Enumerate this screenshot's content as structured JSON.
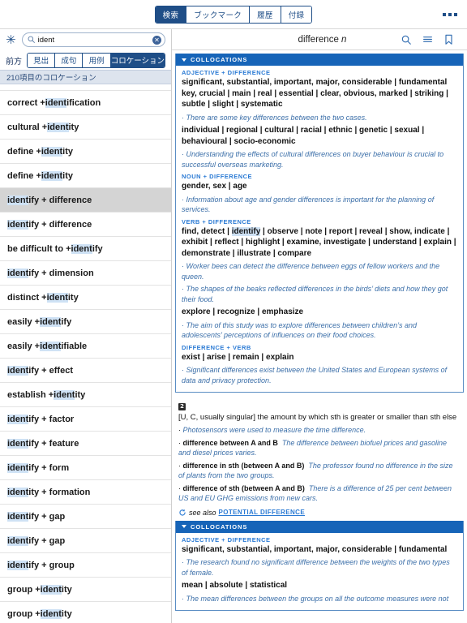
{
  "topbar": {
    "tabs": [
      {
        "label": "検索",
        "active": true
      },
      {
        "label": "ブックマーク",
        "active": false
      },
      {
        "label": "履歴",
        "active": false
      },
      {
        "label": "付録",
        "active": false
      }
    ],
    "overflow_label": "..."
  },
  "sidebar": {
    "asterisk_label": "✳",
    "search": {
      "value": "ident",
      "placeholder": "",
      "clear_label": "✕"
    },
    "filter_label": "前方",
    "filter_tabs": [
      {
        "label": "見出",
        "active": false
      },
      {
        "label": "成句",
        "active": false
      },
      {
        "label": "用例",
        "active": false
      },
      {
        "label": "コロケーション",
        "active": true
      }
    ],
    "result_count": "210項目のコロケーション",
    "rows": [
      {
        "pre": "",
        "hl": "",
        "post": "",
        "partial": true,
        "selected": false
      },
      {
        "pre": "correct + ",
        "hl": "ident",
        "post": "ification",
        "selected": false
      },
      {
        "pre": "cultural + ",
        "hl": "ident",
        "post": "ity",
        "selected": false
      },
      {
        "pre": "define + ",
        "hl": "ident",
        "post": "ity",
        "selected": false
      },
      {
        "pre": "define + ",
        "hl": "ident",
        "post": "ity",
        "selected": false
      },
      {
        "pre": "",
        "hl": "ident",
        "post": "ify + difference",
        "selected": true
      },
      {
        "pre": "",
        "hl": "ident",
        "post": "ify + difference",
        "selected": false
      },
      {
        "pre": "be difficult to + ",
        "hl": "ident",
        "post": "ify",
        "selected": false
      },
      {
        "pre": "",
        "hl": "ident",
        "post": "ify + dimension",
        "selected": false
      },
      {
        "pre": "distinct + ",
        "hl": "ident",
        "post": "ity",
        "selected": false
      },
      {
        "pre": "easily + ",
        "hl": "ident",
        "post": "ify",
        "selected": false
      },
      {
        "pre": "easily + ",
        "hl": "ident",
        "post": "ifiable",
        "selected": false
      },
      {
        "pre": "",
        "hl": "ident",
        "post": "ify + effect",
        "selected": false
      },
      {
        "pre": "establish + ",
        "hl": "ident",
        "post": "ity",
        "selected": false
      },
      {
        "pre": "",
        "hl": "ident",
        "post": "ify + factor",
        "selected": false
      },
      {
        "pre": "",
        "hl": "ident",
        "post": "ify + feature",
        "selected": false
      },
      {
        "pre": "",
        "hl": "ident",
        "post": "ify + form",
        "selected": false
      },
      {
        "pre": "",
        "hl": "ident",
        "post": "ity + formation",
        "selected": false
      },
      {
        "pre": "",
        "hl": "ident",
        "post": "ify + gap",
        "selected": false
      },
      {
        "pre": "",
        "hl": "ident",
        "post": "ify + gap",
        "selected": false
      },
      {
        "pre": "",
        "hl": "ident",
        "post": "ify + group",
        "selected": false
      },
      {
        "pre": "group + ",
        "hl": "ident",
        "post": "ity",
        "selected": false
      },
      {
        "pre": "group + ",
        "hl": "ident",
        "post": "ity",
        "selected": false
      }
    ]
  },
  "entry": {
    "headword": "difference",
    "pos": "n",
    "header_icons": [
      "search-icon",
      "menu-icon",
      "bookmark-icon"
    ]
  },
  "collocations_block_1": {
    "bar_label": "COLLOCATIONS",
    "groups": [
      {
        "heading": "ADJECTIVE + DIFFERENCE",
        "lines": [
          {
            "type": "collocs",
            "text": "significant, substantial, important, major, considerable | fundamental key, crucial | main | real | essential | clear, obvious, marked | striking | subtle | slight | systematic"
          },
          {
            "type": "example",
            "text": "There are some key differences between the two cases."
          },
          {
            "type": "collocs",
            "text": "individual | regional | cultural | racial | ethnic | genetic | sexual | behavioural | socio-economic"
          },
          {
            "type": "example",
            "text": "Understanding the effects of cultural differences on buyer behaviour is crucial to successful overseas marketing."
          }
        ]
      },
      {
        "heading": "NOUN + DIFFERENCE",
        "lines": [
          {
            "type": "collocs",
            "text": "gender, sex | age"
          },
          {
            "type": "example",
            "text": "Information about age and gender differences is important for the planning of services."
          }
        ]
      },
      {
        "heading": "VERB + DIFFERENCE",
        "lines": [
          {
            "type": "collocs_hl",
            "pre": "find, detect | ",
            "hl": "identify",
            "post": " | observe | note | report | reveal | show, indicate | exhibit | reflect | highlight | examine, investigate | understand | explain | demonstrate | illustrate | compare"
          },
          {
            "type": "example",
            "text": "Worker bees can detect the difference between eggs of fellow workers and the queen."
          },
          {
            "type": "example",
            "text": "The shapes of the beaks reflected differences in the birds’ diets and how they got their food."
          },
          {
            "type": "collocs",
            "text": "explore | recognize | emphasize"
          },
          {
            "type": "example",
            "text": "The aim of this study was to explore differences between children’s and adolescents’ perceptions of influences on their food choices."
          }
        ]
      },
      {
        "heading": "DIFFERENCE + VERB",
        "lines": [
          {
            "type": "collocs",
            "text": "exist | arise | remain | explain"
          },
          {
            "type": "example",
            "text": "Significant differences exist between the United States and European systems of data and privacy protection."
          }
        ]
      }
    ]
  },
  "sense_2": {
    "number": "2",
    "definition": "[U, C, usually singular] the amount by which sth is greater or smaller than sth else",
    "items": [
      {
        "type": "example",
        "text": "Photosensors were used to measure the time difference."
      },
      {
        "type": "pattern",
        "pattern": "difference between A and B",
        "example": "The difference between biofuel prices and gasoline and diesel prices varies."
      },
      {
        "type": "pattern",
        "pattern": "difference in sth (between A and B)",
        "example": "The professor found no difference in the size of plants from the two groups."
      },
      {
        "type": "pattern",
        "pattern": "difference of sth (between A and B)",
        "example": "There is a difference of 25 per cent between US and EU GHG emissions from new cars."
      }
    ],
    "see_also_label": "see also",
    "see_also_xref": "POTENTIAL DIFFERENCE"
  },
  "collocations_block_2": {
    "bar_label": "COLLOCATIONS",
    "groups": [
      {
        "heading": "ADJECTIVE + DIFFERENCE",
        "lines": [
          {
            "type": "collocs",
            "text": "significant, substantial, important, major, considerable | fundamental"
          },
          {
            "type": "example",
            "text": "The research found no significant difference between the weights of the two types of female."
          },
          {
            "type": "collocs",
            "text": "mean | absolute | statistical"
          },
          {
            "type": "example",
            "text": "The mean differences between the groups on all the outcome measures were not"
          }
        ]
      }
    ]
  },
  "colors": {
    "accent_blue": "#1f4e87",
    "bar_blue": "#1664b8",
    "cat_blue": "#2a7ad4",
    "example_blue": "#3a6ea8",
    "highlight": "#cfe2f5",
    "selected_row": "#d4d4d4",
    "count_bg": "#dde4ee"
  }
}
